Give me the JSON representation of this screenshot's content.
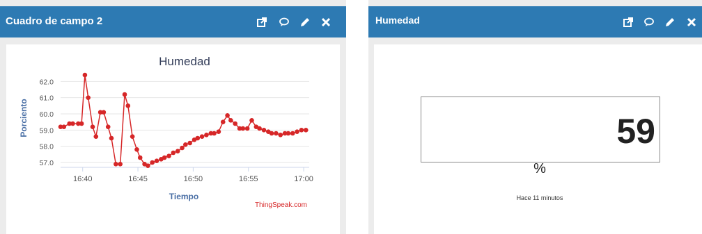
{
  "colors": {
    "header": "#2d7ab3",
    "line": "#d62728",
    "axis_label": "#4a6fa5",
    "brand": "#d62728"
  },
  "left_panel": {
    "title": "Cuadro de campo 2",
    "icons": [
      "external-link-icon",
      "comment-icon",
      "pencil-icon",
      "close-icon"
    ]
  },
  "right_panel": {
    "title": "Humedad",
    "icons": [
      "external-link-icon",
      "comment-icon",
      "pencil-icon",
      "close-icon"
    ],
    "value": "59",
    "unit": "%",
    "timestamp": "Hace 11 minutos"
  },
  "chart_data": {
    "type": "line",
    "title": "Humedad",
    "xlabel": "Tiempo",
    "ylabel": "Porciento",
    "credit": "ThingSpeak.com",
    "x_ticks": [
      "16:40",
      "16:45",
      "16:50",
      "16:55",
      "17:00"
    ],
    "y_ticks": [
      "57.0",
      "58.0",
      "59.0",
      "60.0",
      "61.0",
      "62.0"
    ],
    "ylim": [
      56.7,
      62.7
    ],
    "xlim": [
      "16:38",
      "17:00.5"
    ],
    "grid": true,
    "legend": false,
    "series": [
      {
        "x": [
          "16:38.0",
          "16:38.3",
          "16:38.8",
          "16:39.1",
          "16:39.6",
          "16:39.9",
          "16:40.2",
          "16:40.5",
          "16:40.9",
          "16:41.2",
          "16:41.6",
          "16:41.9",
          "16:42.3",
          "16:42.6",
          "16:43.0",
          "16:43.4",
          "16:43.8",
          "16:44.1",
          "16:44.5",
          "16:44.9",
          "16:45.2",
          "16:45.6",
          "16:45.9",
          "16:46.3",
          "16:46.7",
          "16:47.1",
          "16:47.4",
          "16:47.8",
          "16:48.2",
          "16:48.6",
          "16:49.0",
          "16:49.3",
          "16:49.7",
          "16:50.1",
          "16:50.4",
          "16:50.8",
          "16:51.2",
          "16:51.6",
          "16:51.9",
          "16:52.3",
          "16:52.7",
          "16:53.1",
          "16:53.4",
          "16:53.8",
          "16:54.2",
          "16:54.5",
          "16:54.9",
          "16:55.3",
          "16:55.7",
          "16:56.0",
          "16:56.4",
          "16:56.8",
          "16:57.1",
          "16:57.5",
          "16:57.9",
          "16:58.3",
          "16:58.6",
          "16:59.0",
          "16:59.4",
          "16:59.8",
          "17:00.2"
        ],
        "y": [
          59.2,
          59.2,
          59.4,
          59.4,
          59.4,
          59.4,
          62.4,
          61.0,
          59.2,
          58.6,
          60.1,
          60.1,
          59.2,
          58.5,
          56.9,
          56.9,
          61.2,
          60.5,
          58.6,
          57.8,
          57.3,
          56.9,
          56.8,
          57.0,
          57.1,
          57.2,
          57.3,
          57.4,
          57.6,
          57.7,
          57.9,
          58.1,
          58.2,
          58.4,
          58.5,
          58.6,
          58.7,
          58.8,
          58.8,
          58.9,
          59.5,
          59.9,
          59.6,
          59.4,
          59.1,
          59.1,
          59.1,
          59.6,
          59.2,
          59.1,
          59.0,
          58.9,
          58.8,
          58.8,
          58.7,
          58.8,
          58.8,
          58.8,
          58.9,
          59.0,
          59.0
        ]
      }
    ]
  }
}
